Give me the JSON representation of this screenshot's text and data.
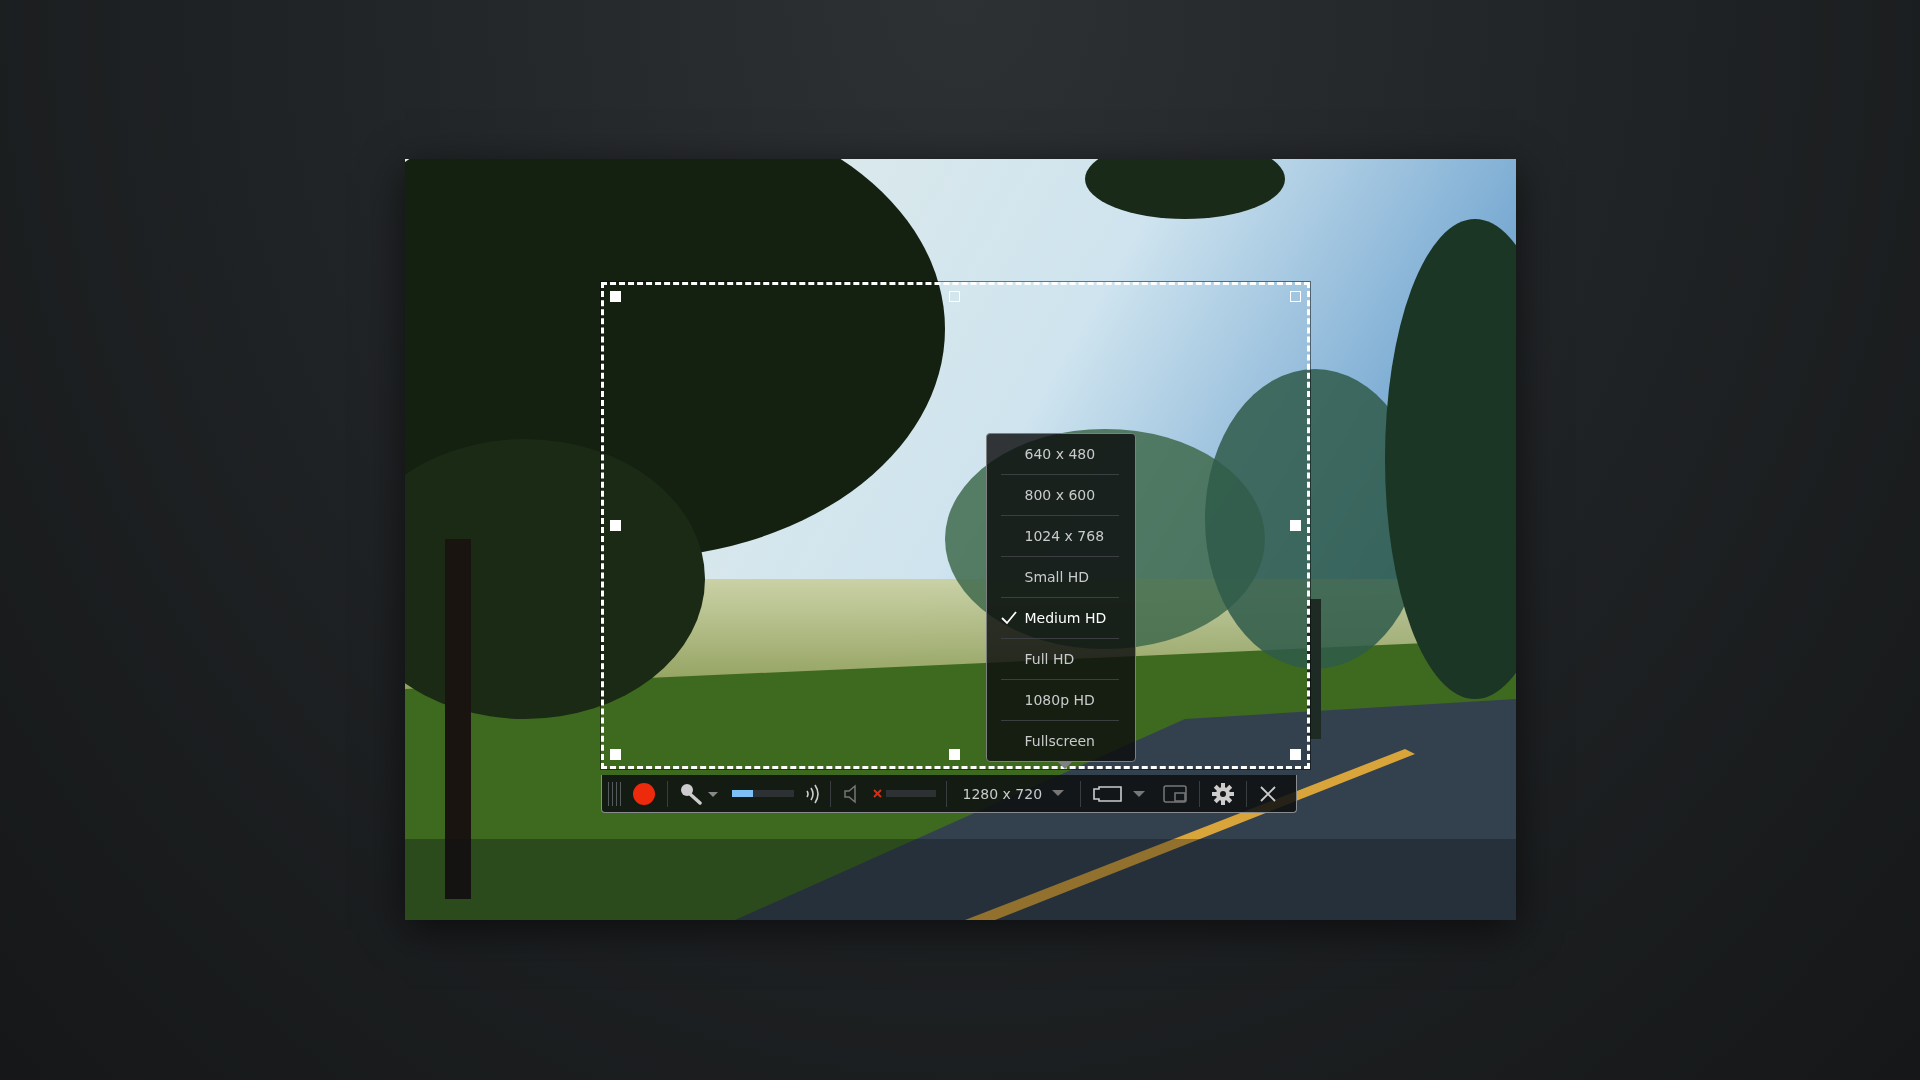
{
  "toolbar": {
    "microphone": {
      "level": 0.35
    },
    "speaker": {
      "muted": true,
      "level": 0
    },
    "resolution": "1280 x 720"
  },
  "resolution_menu": {
    "items": [
      {
        "label": "640 x 480",
        "selected": false
      },
      {
        "label": "800 x 600",
        "selected": false
      },
      {
        "label": "1024 x 768",
        "selected": false
      },
      {
        "label": "Small HD",
        "selected": false
      },
      {
        "label": "Medium HD",
        "selected": true
      },
      {
        "label": "Full HD",
        "selected": false
      },
      {
        "label": "1080p HD",
        "selected": false
      },
      {
        "label": "Fullscreen",
        "selected": false
      }
    ]
  }
}
